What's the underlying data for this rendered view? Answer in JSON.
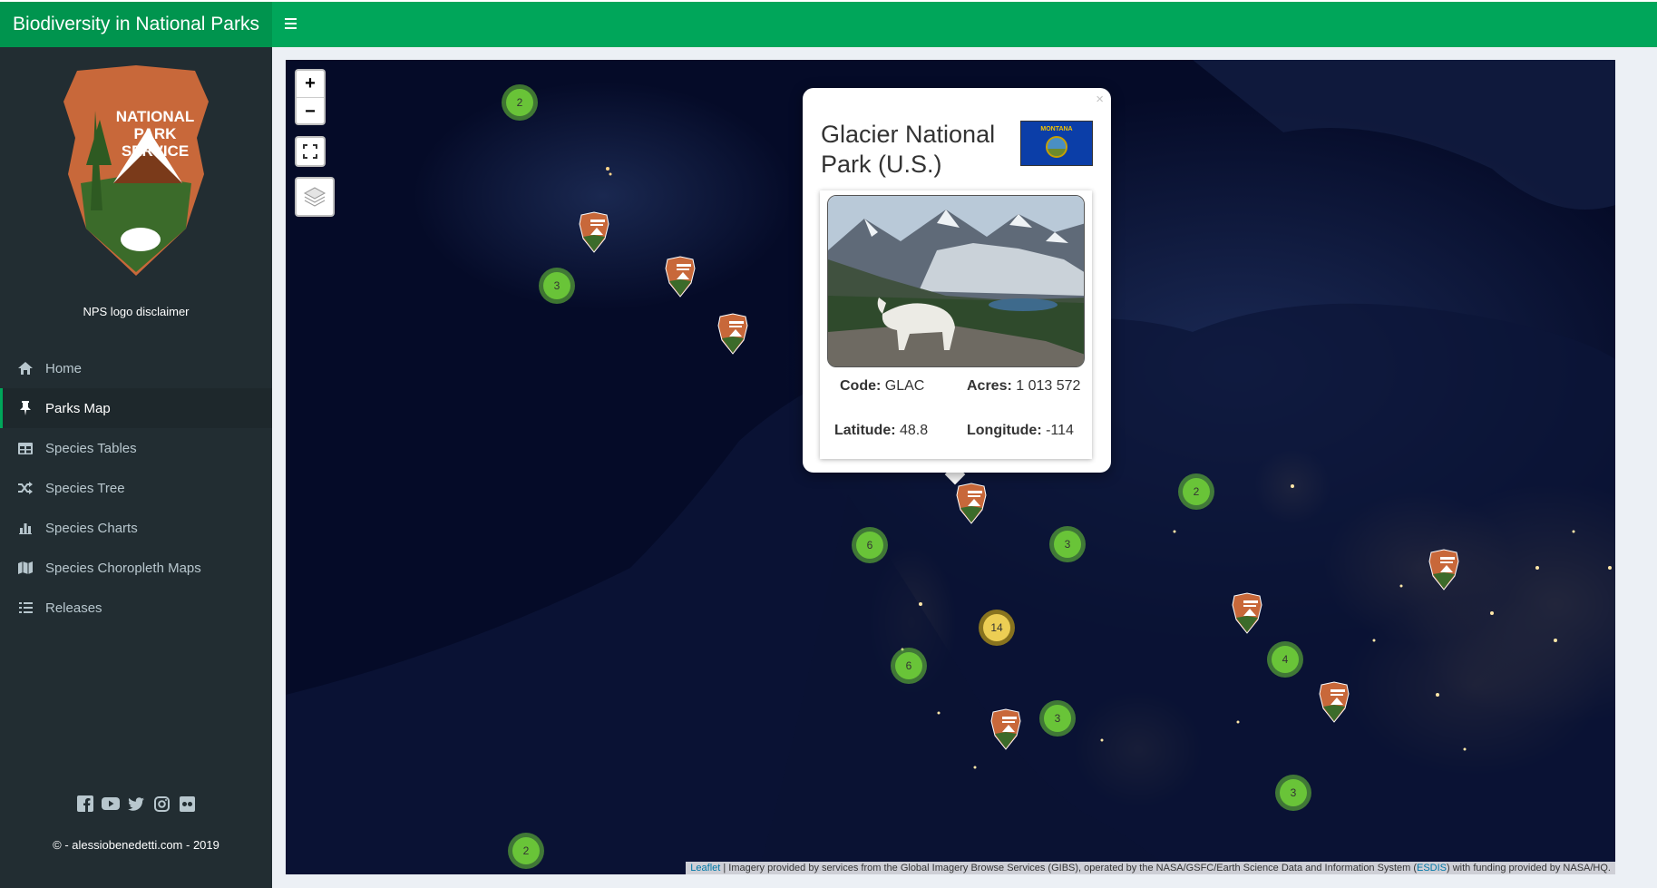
{
  "header": {
    "title": "Biodiversity in National Parks"
  },
  "sidebar": {
    "logo": {
      "line1": "NATIONAL",
      "line2": "PARK",
      "line3": "SERVICE"
    },
    "logo_disclaimer": "NPS logo disclaimer",
    "items": [
      {
        "label": "Home",
        "icon": "home-icon",
        "active": false
      },
      {
        "label": "Parks Map",
        "icon": "pin-icon",
        "active": true
      },
      {
        "label": "Species Tables",
        "icon": "table-icon",
        "active": false
      },
      {
        "label": "Species Tree",
        "icon": "random-icon",
        "active": false
      },
      {
        "label": "Species Charts",
        "icon": "bar-chart-icon",
        "active": false
      },
      {
        "label": "Species Choropleth Maps",
        "icon": "map-icon",
        "active": false
      },
      {
        "label": "Releases",
        "icon": "tasks-icon",
        "active": false
      }
    ],
    "social": [
      "facebook-icon",
      "youtube-icon",
      "twitter-icon",
      "instagram-icon",
      "flickr-icon"
    ],
    "copyright": "© - alessiobenedetti.com - 2019"
  },
  "map": {
    "controls": {
      "zoom_in": "+",
      "zoom_out": "−"
    },
    "clusters": [
      {
        "count": "2"
      },
      {
        "count": "3"
      },
      {
        "count": "2"
      },
      {
        "count": "6"
      },
      {
        "count": "3"
      },
      {
        "count": "14"
      },
      {
        "count": "6"
      },
      {
        "count": "3"
      },
      {
        "count": "4"
      },
      {
        "count": "3"
      },
      {
        "count": "2"
      }
    ],
    "attribution": {
      "leaflet": "Leaflet",
      "text1": " | Imagery provided by services from the Global Imagery Browse Services (GIBS), operated by the NASA/GSFC/Earth Science Data and Information System (",
      "esdis": "ESDIS",
      "text2": ") with funding provided by NASA/HQ."
    }
  },
  "popup": {
    "close": "×",
    "title": "Glacier National Park (U.S.)",
    "flag_text": "MONTANA",
    "code_label": "Code:",
    "code_value": "GLAC",
    "acres_label": "Acres:",
    "acres_value": "1 013 572",
    "lat_label": "Latitude:",
    "lat_value": "48.8",
    "lon_label": "Longitude:",
    "lon_value": "-114"
  },
  "colors": {
    "brand": "#00a65a",
    "sidebar": "#222d32",
    "cluster_small": "#6ecc39",
    "cluster_large": "#f0c20c"
  }
}
